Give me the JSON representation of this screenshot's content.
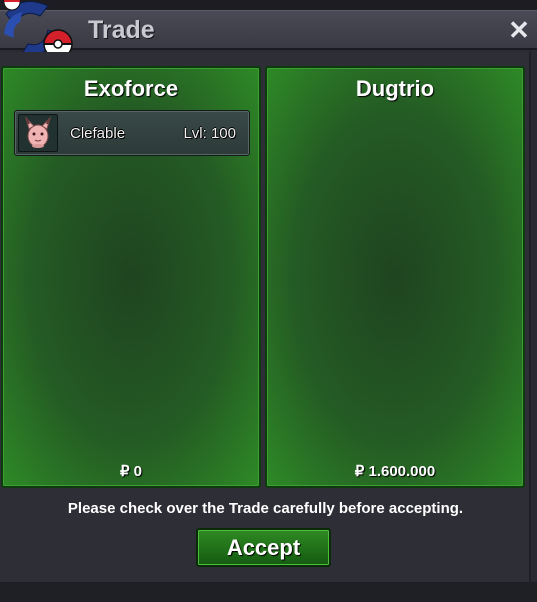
{
  "window": {
    "title": "Trade",
    "close_symbol": "✕"
  },
  "logo": {
    "icon": "pokeball-swirl-icon"
  },
  "left_panel": {
    "player_name": "Exoforce",
    "money": "₽ 0",
    "slots": [
      {
        "pokemon": "Clefable",
        "level": "Lvl: 100",
        "icon": "clefable-sprite-icon"
      }
    ]
  },
  "right_panel": {
    "player_name": "Dugtrio",
    "money": "₽ 1.600.000",
    "slots": []
  },
  "footer": {
    "notice": "Please check over the Trade carefully before accepting.",
    "accept_label": "Accept"
  },
  "colors": {
    "panel_green": "#2e8a26",
    "title_bg": "#3a3a44",
    "button_green": "#2f8a22"
  }
}
